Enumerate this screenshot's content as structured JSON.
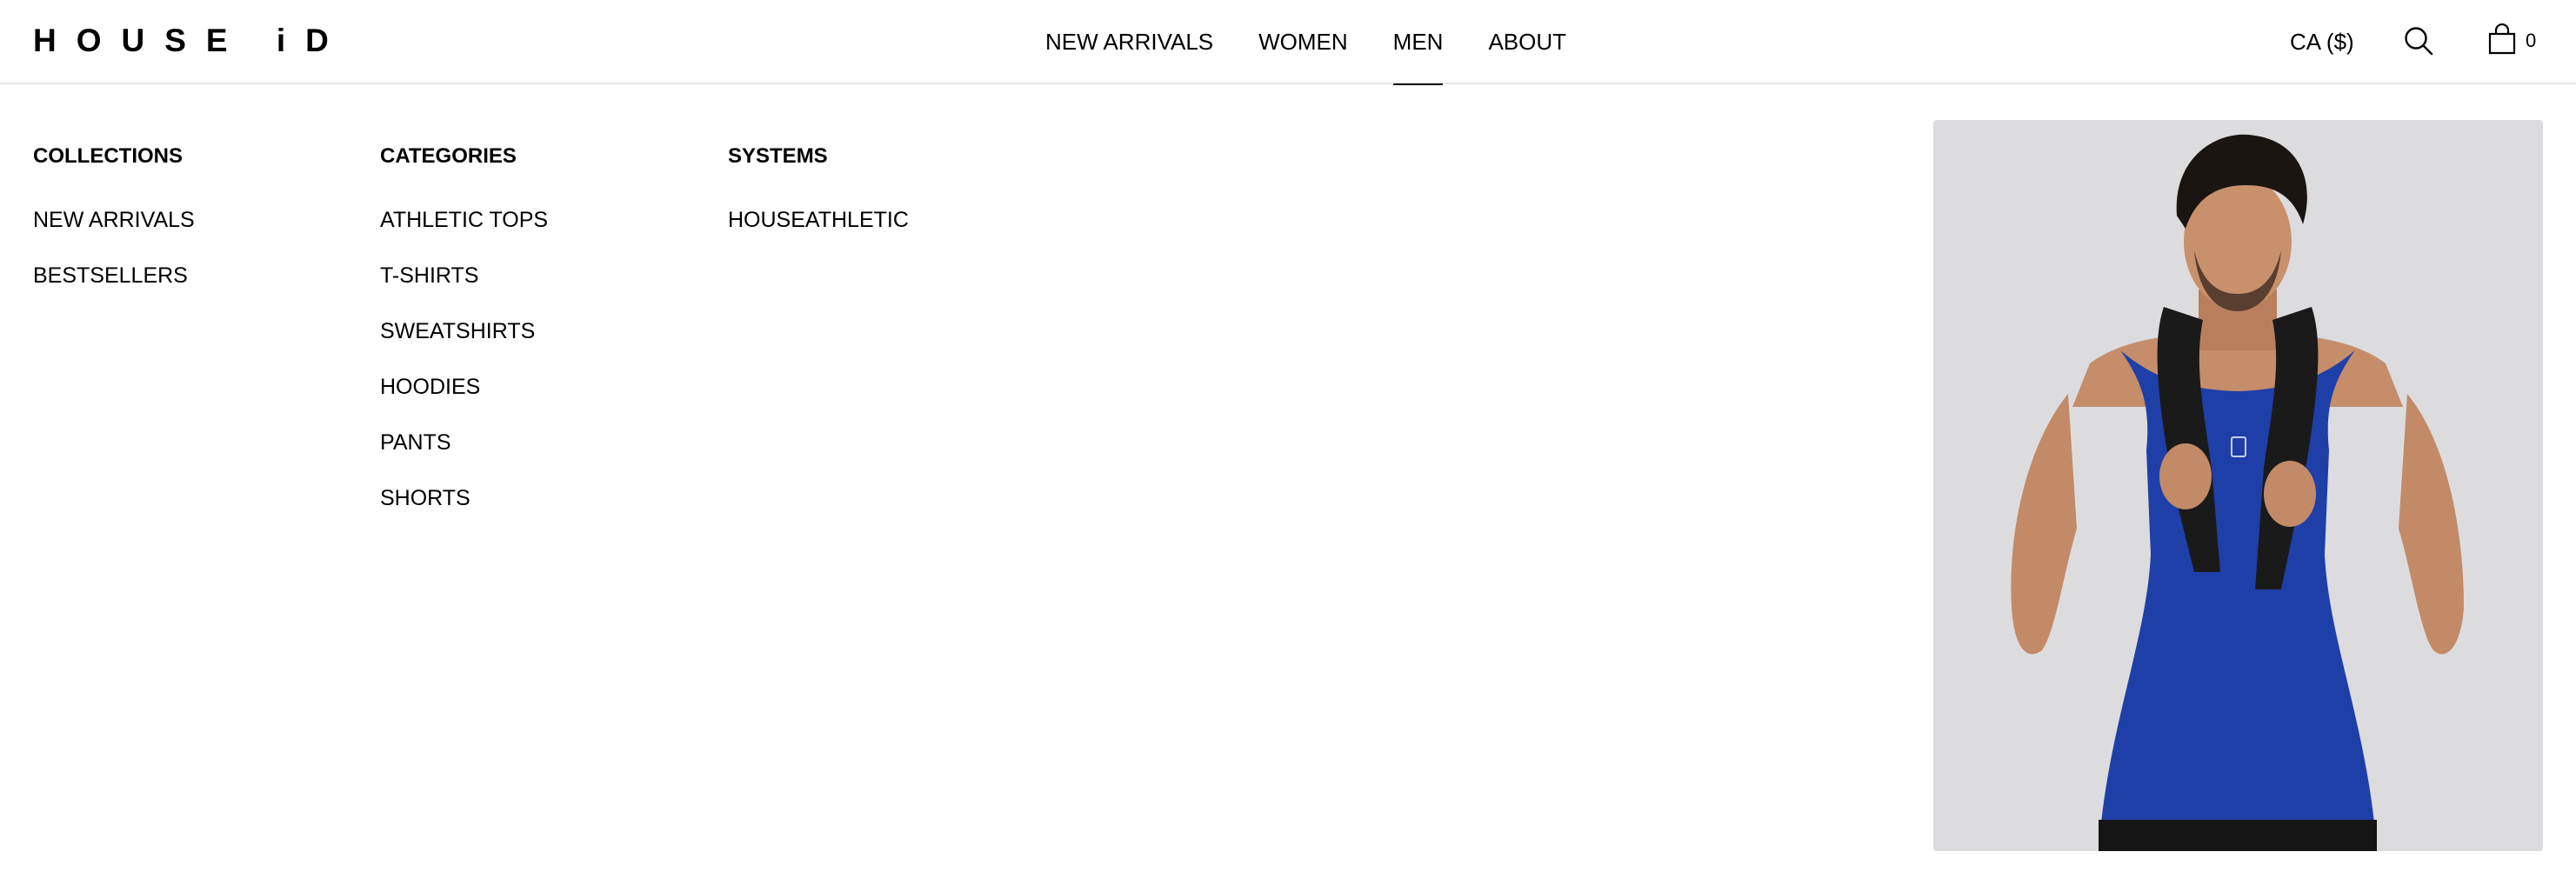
{
  "header": {
    "logo": "HOUSE iD",
    "nav": [
      {
        "label": "NEW ARRIVALS"
      },
      {
        "label": "WOMEN"
      },
      {
        "label": "MEN"
      },
      {
        "label": "ABOUT"
      }
    ],
    "active_nav": "MEN",
    "currency": "CA ($)",
    "cart_count": "0"
  },
  "mega_menu": {
    "collections": {
      "heading": "COLLECTIONS",
      "items": [
        "NEW ARRIVALS",
        "BESTSELLERS"
      ]
    },
    "categories": {
      "heading": "CATEGORIES",
      "items": [
        "ATHLETIC TOPS",
        "T-SHIRTS",
        "SWEATSHIRTS",
        "HOODIES",
        "PANTS",
        "SHORTS"
      ]
    },
    "systems": {
      "heading": "SYSTEMS",
      "items": [
        "HOUSEATHLETIC"
      ]
    }
  },
  "colors": {
    "text": "#000000",
    "divider": "#e6e6e6",
    "promo_background": "#dcdcde",
    "tank_top": "#1f3fa8"
  }
}
